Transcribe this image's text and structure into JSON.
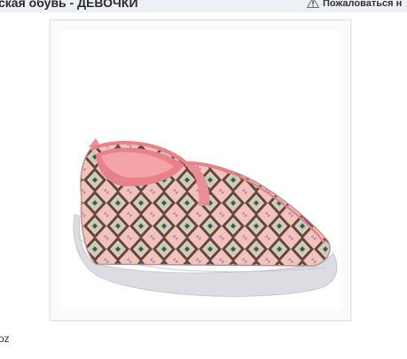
{
  "header": {
    "title": "ская обувь - ДЕВОЧКИ",
    "report_link": "Пожаловаться н",
    "warning_icon": "warning-triangle-icon"
  },
  "product": {
    "image_subject": "pink-slip-on-sneaker-ikat-pattern",
    "colors": {
      "base": "#f2b8ac",
      "lining": "#e8818a",
      "pattern_dark": "#5e4a44",
      "pattern_green": "#a9d8bb",
      "pattern_purple": "#b48ed2",
      "sole": "#d9d9de"
    }
  },
  "footer": {
    "text": "oz"
  }
}
